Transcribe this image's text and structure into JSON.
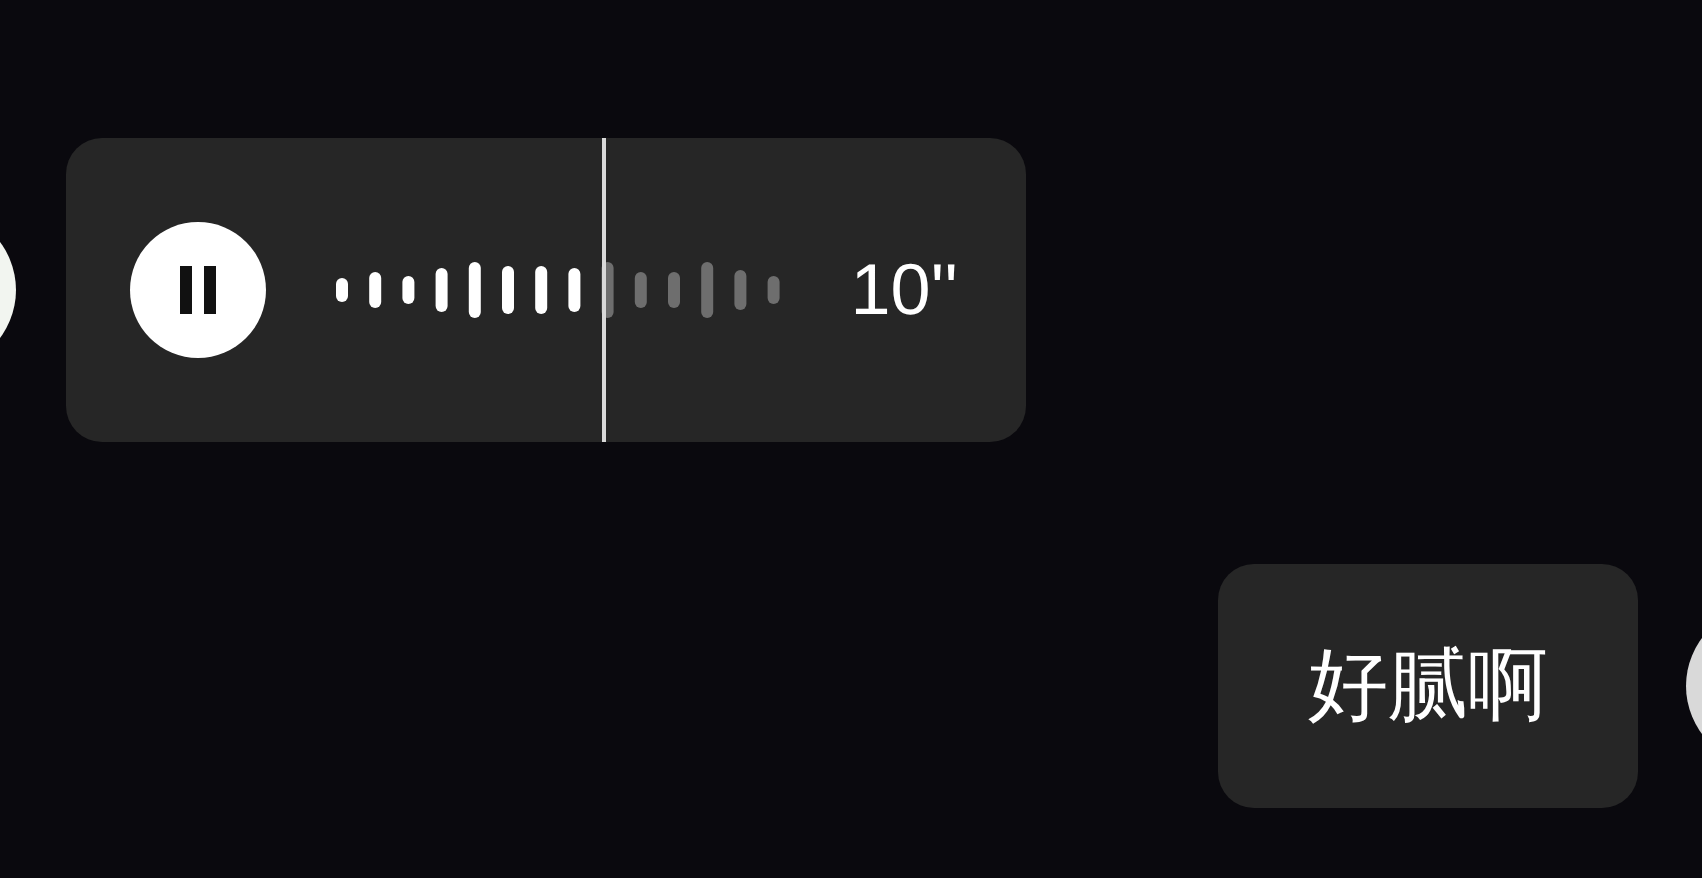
{
  "messages": [
    {
      "kind": "voice",
      "outgoing": false,
      "playing": true,
      "level": 0.6,
      "duration": "10''"
    },
    {
      "kind": "text",
      "outgoing": true,
      "text": "好腻啊"
    }
  ]
}
